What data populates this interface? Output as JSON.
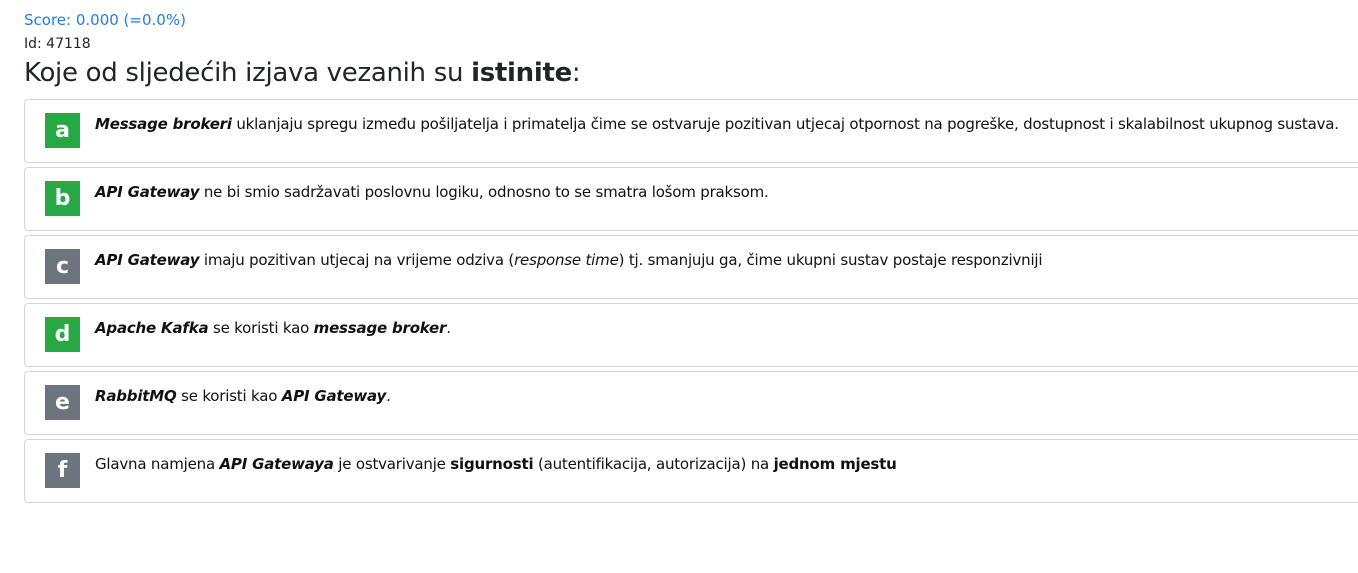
{
  "header": {
    "score": "Score: 0.000 (=0.0%)",
    "id": "Id: 47118"
  },
  "question": {
    "prefix": "Koje od sljedećih izjava vezanih su ",
    "emphasis": "istinite",
    "suffix": ":"
  },
  "colors": {
    "correct": "#28a745",
    "incorrect": "#6c757d",
    "score": "#1e7fe6"
  },
  "answers": [
    {
      "letter": "a",
      "state": "correct",
      "parts": [
        {
          "t": "Message brokeri",
          "s": "bi"
        },
        {
          "t": " uklanjaju spregu između pošiljatelja i primatelja čime se ostvaruje pozitivan utjecaj otpornost na pogreške, dostupnost i skalabilnost ukupnog sustava.",
          "s": ""
        }
      ]
    },
    {
      "letter": "b",
      "state": "correct",
      "parts": [
        {
          "t": "API Gateway",
          "s": "bi"
        },
        {
          "t": " ne bi smio sadržavati poslovnu logiku, odnosno to se smatra lošom praksom.",
          "s": ""
        }
      ]
    },
    {
      "letter": "c",
      "state": "incorrect",
      "parts": [
        {
          "t": "API Gateway",
          "s": "bi"
        },
        {
          "t": " imaju pozitivan utjecaj na vrijeme odziva (",
          "s": ""
        },
        {
          "t": "response time",
          "s": "i"
        },
        {
          "t": ") tj. smanjuju ga, čime ukupni sustav postaje responzivniji",
          "s": ""
        }
      ]
    },
    {
      "letter": "d",
      "state": "correct",
      "parts": [
        {
          "t": "Apache Kafka",
          "s": "bi"
        },
        {
          "t": " se koristi kao ",
          "s": ""
        },
        {
          "t": "message broker",
          "s": "bi"
        },
        {
          "t": ".",
          "s": ""
        }
      ]
    },
    {
      "letter": "e",
      "state": "incorrect",
      "parts": [
        {
          "t": "RabbitMQ",
          "s": "bi"
        },
        {
          "t": " se koristi kao ",
          "s": ""
        },
        {
          "t": "API Gateway",
          "s": "bi"
        },
        {
          "t": ".",
          "s": ""
        }
      ]
    },
    {
      "letter": "f",
      "state": "incorrect",
      "parts": [
        {
          "t": "Glavna namjena ",
          "s": ""
        },
        {
          "t": "API Gatewaya",
          "s": "bi"
        },
        {
          "t": " je ostvarivanje ",
          "s": ""
        },
        {
          "t": "sigurnosti",
          "s": "b"
        },
        {
          "t": " (autentifikacija, autorizacija) na ",
          "s": ""
        },
        {
          "t": "jednom mjestu",
          "s": "b"
        }
      ]
    }
  ]
}
